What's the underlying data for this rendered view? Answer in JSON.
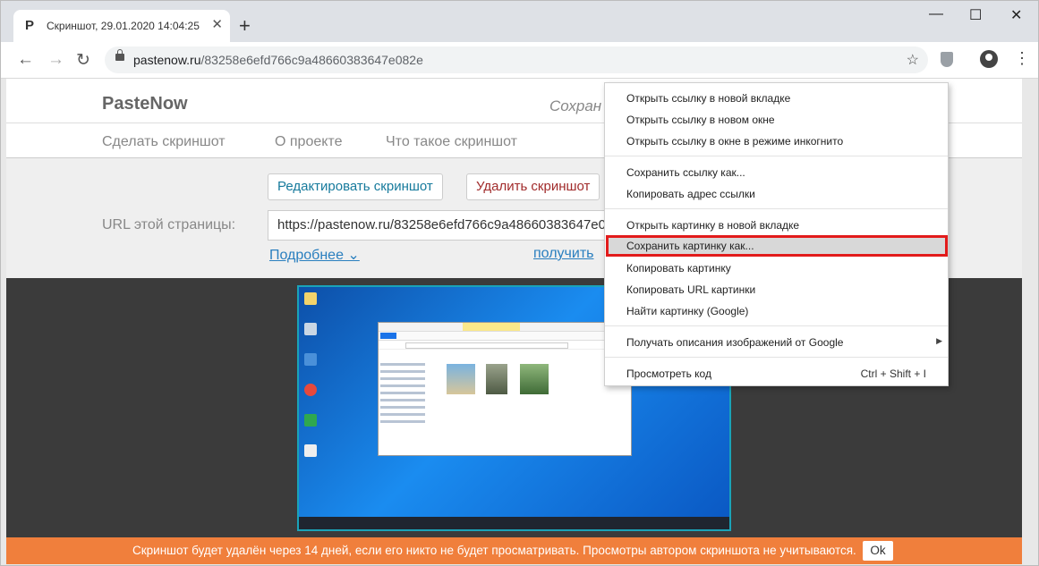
{
  "browser": {
    "tab": {
      "icon": "P",
      "title": "Скриншот, 29.01.2020 14:04:25",
      "close": "✕"
    },
    "new_tab": "+",
    "window_controls": {
      "minimize": "—",
      "maximize": "☐",
      "close": "✕"
    },
    "nav": {
      "back": "←",
      "forward": "→",
      "reload": "↻"
    },
    "url": {
      "host": "pastenow.ru",
      "path": "/83258e6efd766c9a48660383647e082e"
    },
    "bookmark_star": "☆",
    "menu_dots": "⋮"
  },
  "site": {
    "logo": "PasteNow",
    "saved_partial": "Сохран",
    "nav": [
      "Сделать скриншот",
      "О проекте",
      "Что такое скриншот"
    ],
    "edit_button": "Редактировать скриншот",
    "delete_button": "Удалить скриншот",
    "url_label": "URL этой страницы:",
    "url_value": "https://pastenow.ru/83258e6efd766c9a48660383647e082e",
    "more_link": "Подробнее ⌄",
    "get_link": "получить"
  },
  "notice": {
    "text": "Скриншот будет удалён через 14 дней, если его никто не будет просматривать. Просмотры автором скриншота не учитываются.",
    "ok": "Ok"
  },
  "context_menu": {
    "items": [
      "Открыть ссылку в новой вкладке",
      "Открыть ссылку в новом окне",
      "Открыть ссылку в окне в режиме инкогнито",
      "Сохранить ссылку как...",
      "Копировать адрес ссылки",
      "Открыть картинку в новой вкладке",
      "Сохранить картинку как...",
      "Копировать картинку",
      "Копировать URL картинки",
      "Найти картинку (Google)",
      "Получать описания изображений от Google",
      "Просмотреть код"
    ],
    "submenu_arrow": "▶",
    "shortcut": "Ctrl + Shift + I",
    "highlighted_index": 6
  },
  "colors": {
    "accent_orange": "#f07f3c",
    "highlight_border": "#e21b1b",
    "link": "#2a7fbf"
  }
}
